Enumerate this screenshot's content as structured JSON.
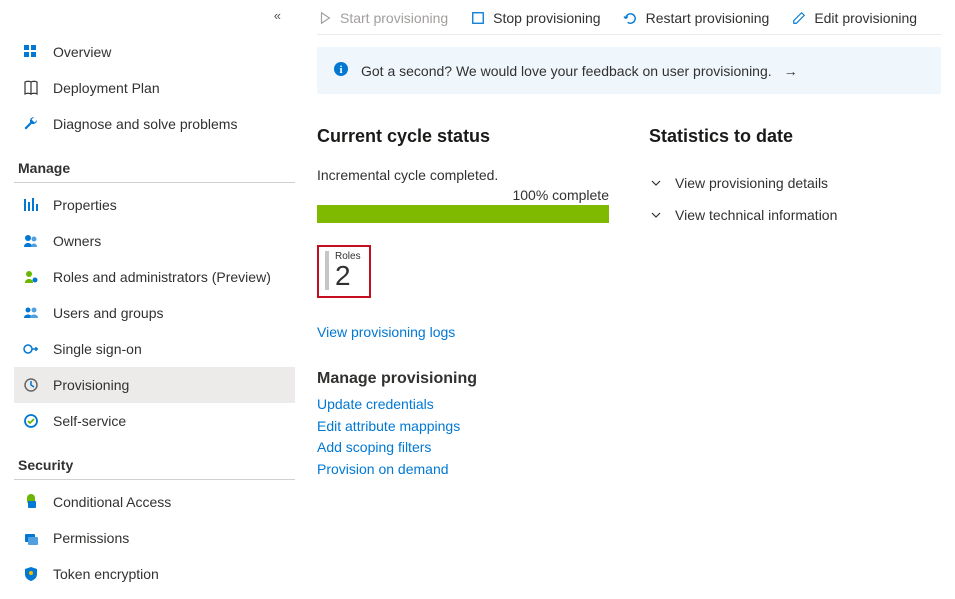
{
  "sidebar": {
    "items_top": [
      {
        "label": "Overview"
      },
      {
        "label": "Deployment Plan"
      },
      {
        "label": "Diagnose and solve problems"
      }
    ],
    "section_manage": "Manage",
    "items_manage": [
      {
        "label": "Properties"
      },
      {
        "label": "Owners"
      },
      {
        "label": "Roles and administrators (Preview)"
      },
      {
        "label": "Users and groups"
      },
      {
        "label": "Single sign-on"
      },
      {
        "label": "Provisioning"
      },
      {
        "label": "Self-service"
      }
    ],
    "section_security": "Security",
    "items_security": [
      {
        "label": "Conditional Access"
      },
      {
        "label": "Permissions"
      },
      {
        "label": "Token encryption"
      }
    ]
  },
  "toolbar": {
    "start": "Start provisioning",
    "stop": "Stop provisioning",
    "restart": "Restart provisioning",
    "edit": "Edit provisioning"
  },
  "feedback": {
    "text": "Got a second? We would love your feedback on user provisioning."
  },
  "current_cycle": {
    "heading": "Current cycle status",
    "status": "Incremental cycle completed.",
    "complete_label": "100% complete",
    "roles_label": "Roles",
    "roles_count": "2",
    "logs_link": "View provisioning logs"
  },
  "stats": {
    "heading": "Statistics to date",
    "expanders": [
      {
        "label": "View provisioning details"
      },
      {
        "label": "View technical information"
      }
    ]
  },
  "manage_provisioning": {
    "heading": "Manage provisioning",
    "links": [
      "Update credentials",
      "Edit attribute mappings",
      "Add scoping filters",
      "Provision on demand"
    ]
  }
}
